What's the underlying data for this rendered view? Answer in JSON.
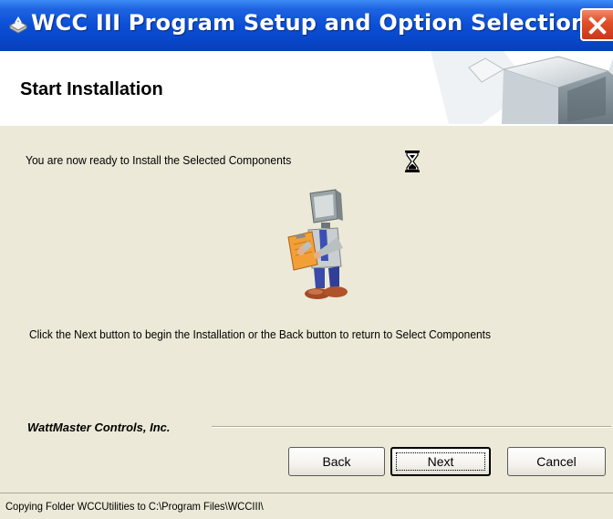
{
  "window": {
    "title": "WCC III Program Setup and Option Selection",
    "title_bar_color": "#0a4fd6",
    "close_icon": "close-icon"
  },
  "header": {
    "title": "Start Installation",
    "art": "open-box-graphic"
  },
  "main": {
    "ready_text": "You are now ready to Install the Selected Components",
    "busy_icon": "hourglass-icon",
    "illustration": "computer-head-mascot-reading-clipboard",
    "instruction_text": "Click the Next button to begin the Installation or the Back button to return to Select Components"
  },
  "footer": {
    "brand": "WattMaster Controls, Inc."
  },
  "buttons": {
    "back_label": "Back",
    "next_label": "Next",
    "cancel_label": "Cancel"
  },
  "status": {
    "text": "Copying Folder WCCUtilities to C:\\Program Files\\WCCIII\\"
  }
}
